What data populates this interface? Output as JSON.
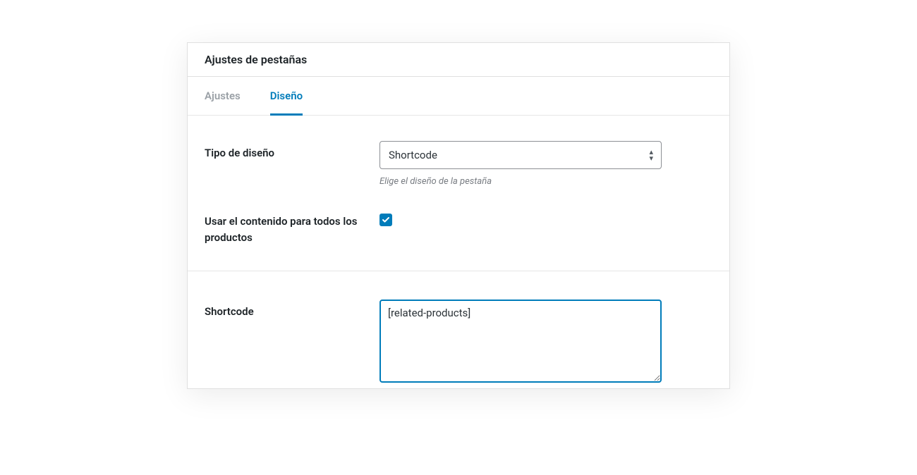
{
  "colors": {
    "accent": "#007cba"
  },
  "panel": {
    "title": "Ajustes de pestañas"
  },
  "tabs": [
    {
      "label": "Ajustes",
      "active": false
    },
    {
      "label": "Diseño",
      "active": true
    }
  ],
  "form": {
    "layout_type": {
      "label": "Tipo de diseño",
      "value": "Shortcode",
      "helper": "Elige el diseño de la pestaña"
    },
    "use_all": {
      "label": "Usar el contenido para todos los productos",
      "checked": true
    },
    "shortcode": {
      "label": "Shortcode",
      "value": "[related-products]"
    }
  }
}
